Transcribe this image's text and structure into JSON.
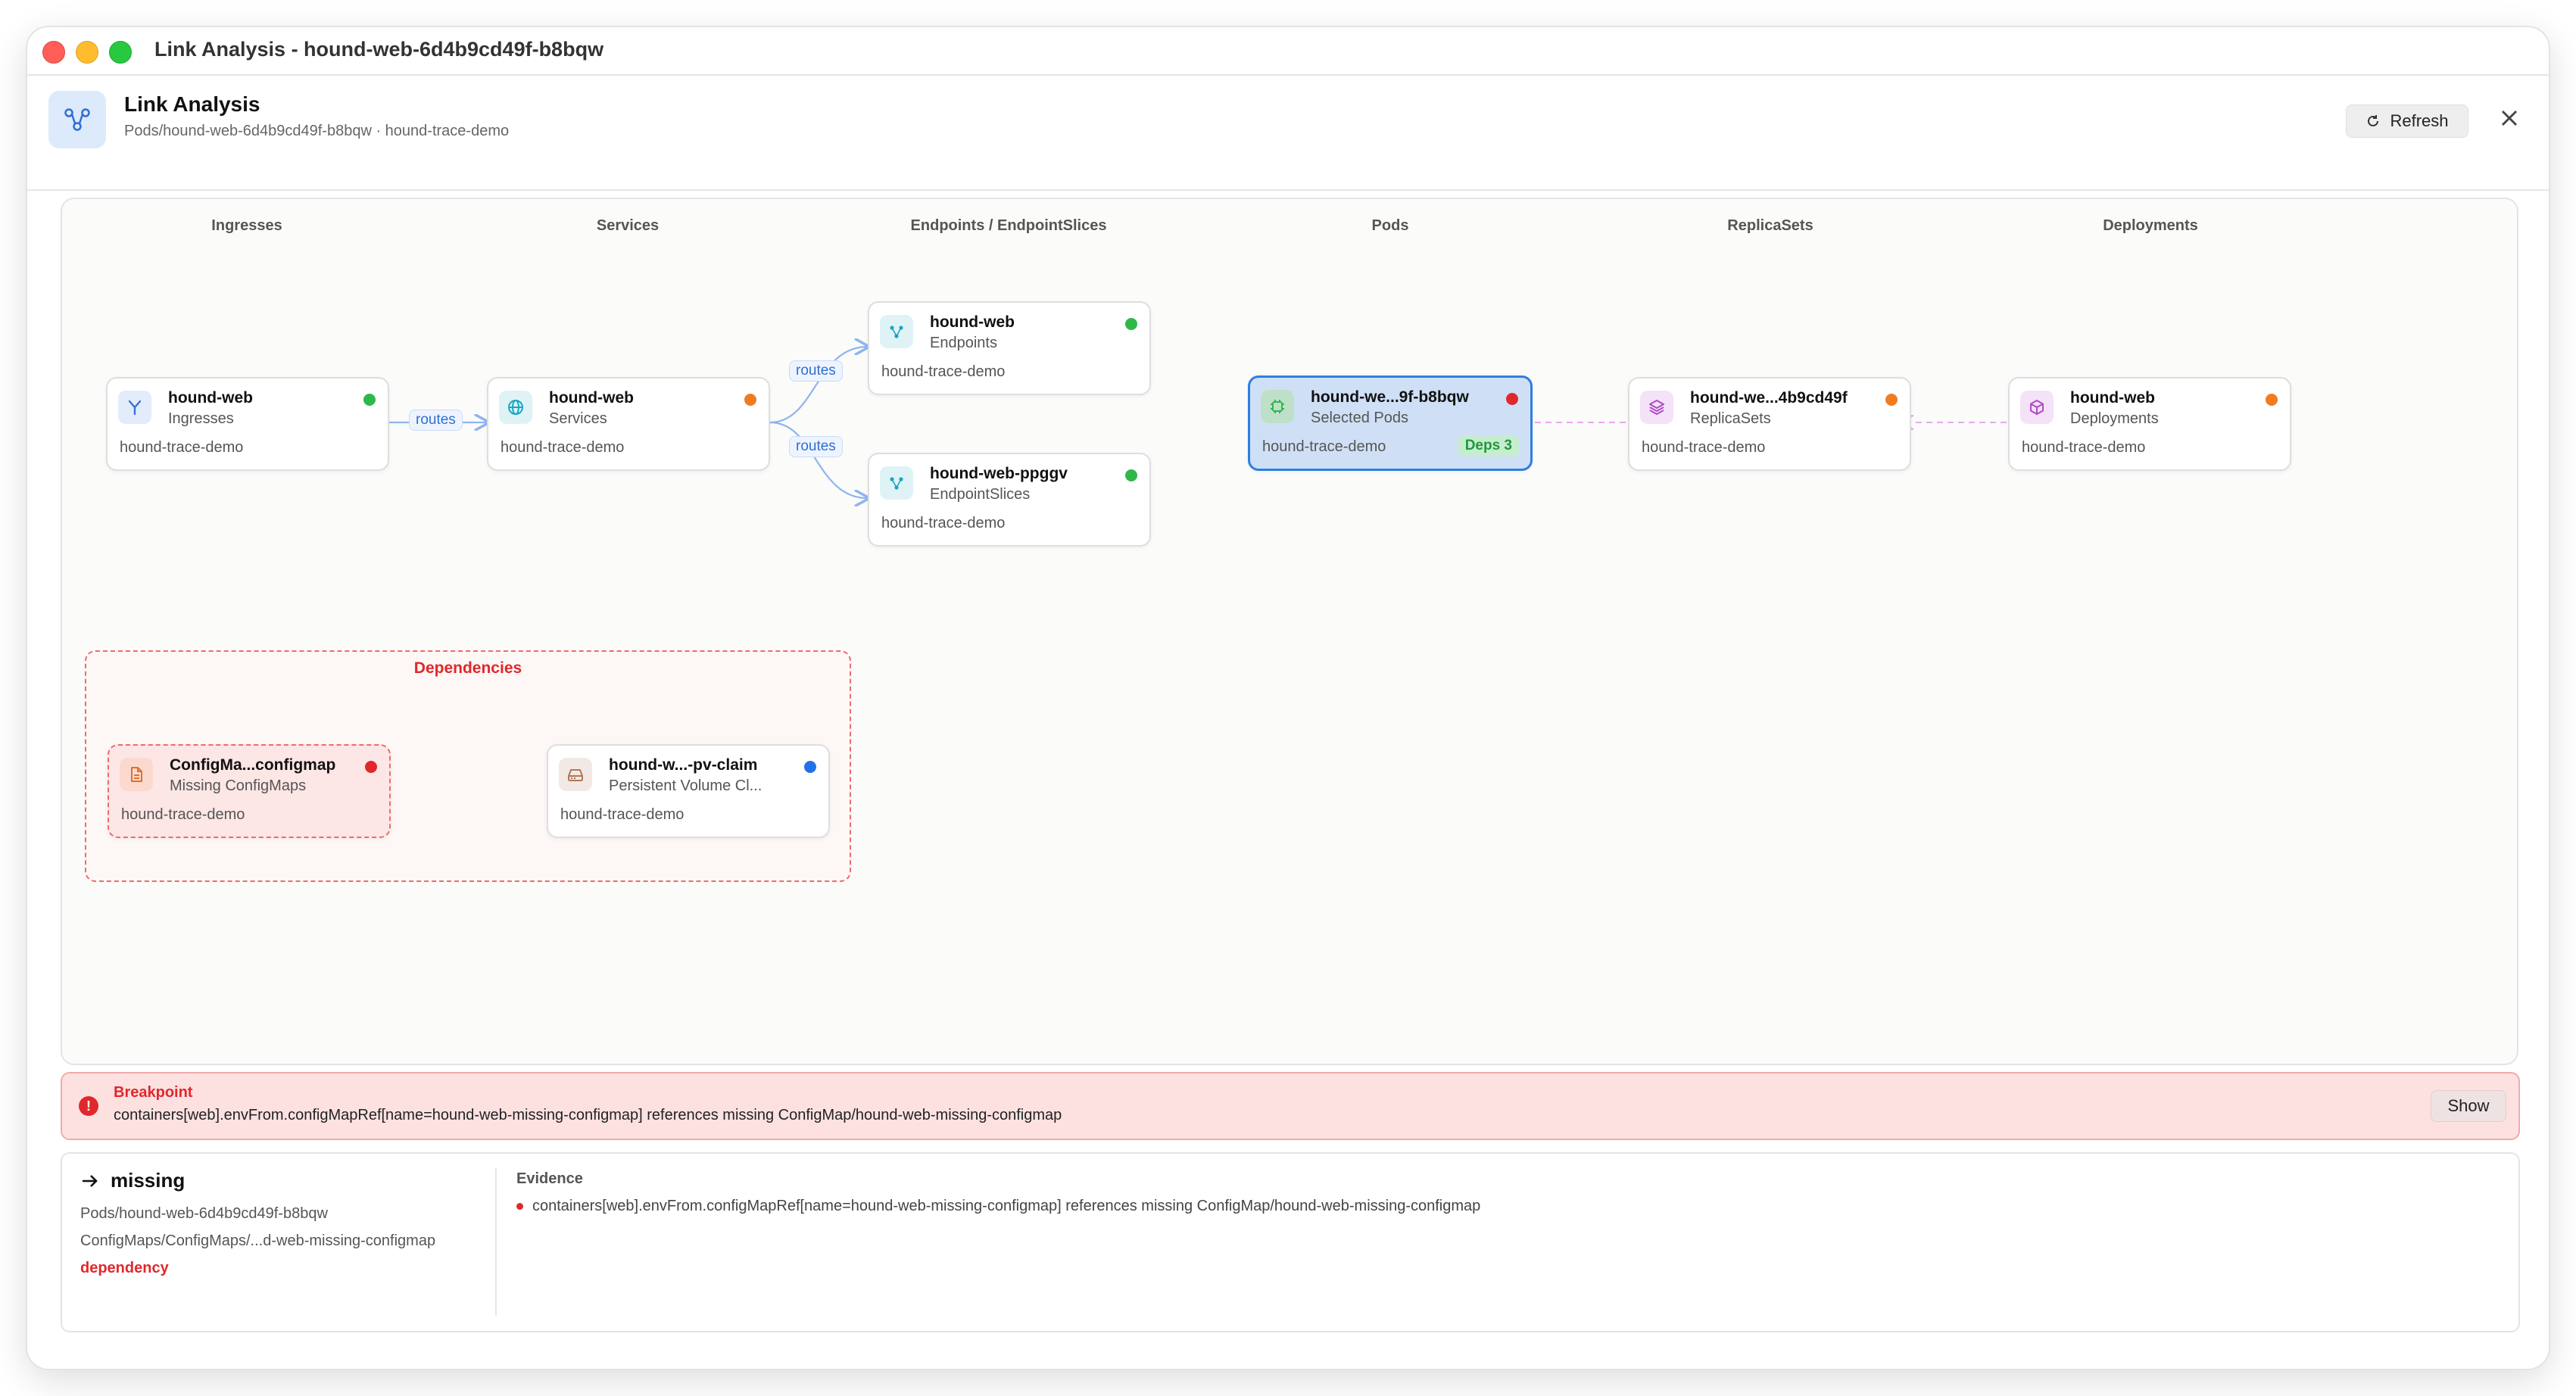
{
  "window": {
    "title": "Link Analysis - hound-web-6d4b9cd49f-b8bqw"
  },
  "header": {
    "title": "Link Analysis",
    "subtitle": "Pods/hound-web-6d4b9cd49f-b8bqw · hound-trace-demo",
    "refresh_label": "Refresh"
  },
  "columns": [
    "Ingresses",
    "Services",
    "Endpoints / EndpointSlices",
    "Pods",
    "ReplicaSets",
    "Deployments"
  ],
  "nodes": {
    "ingress": {
      "name": "hound-web",
      "kind": "Ingresses",
      "namespace": "hound-trace-demo",
      "status_color": "#2fb84a",
      "icon_color": "#3b6fd8",
      "icon_bg": "#e3ecfb"
    },
    "service": {
      "name": "hound-web",
      "kind": "Services",
      "namespace": "hound-trace-demo",
      "status_color": "#f07c22",
      "icon_color": "#1aa6c2",
      "icon_bg": "#dff3f7"
    },
    "endpoints": {
      "name": "hound-web",
      "kind": "Endpoints",
      "namespace": "hound-trace-demo",
      "status_color": "#2fb84a",
      "icon_color": "#1aa6c2",
      "icon_bg": "#dff3f7"
    },
    "endpointslice": {
      "name": "hound-web-ppggv",
      "kind": "EndpointSlices",
      "namespace": "hound-trace-demo",
      "status_color": "#2fb84a",
      "icon_color": "#1aa6c2",
      "icon_bg": "#dff3f7"
    },
    "pod": {
      "name": "hound-we...9f-b8bqw",
      "kind": "Selected Pods",
      "namespace": "hound-trace-demo",
      "status_color": "#e0282c",
      "deps_label": "Deps 3",
      "icon_color": "#2fb84a",
      "icon_bg": "#bfe0c8"
    },
    "replicaset": {
      "name": "hound-we...4b9cd49f",
      "kind": "ReplicaSets",
      "namespace": "hound-trace-demo",
      "status_color": "#f07c22",
      "icon_color": "#b04ac8",
      "icon_bg": "#f4e2f8"
    },
    "deployment": {
      "name": "hound-web",
      "kind": "Deployments",
      "namespace": "hound-trace-demo",
      "status_color": "#f07c22",
      "icon_color": "#b04ac8",
      "icon_bg": "#f4e2f8"
    },
    "configmap": {
      "name": "ConfigMa...configmap",
      "kind": "Missing ConfigMaps",
      "namespace": "hound-trace-demo",
      "status_color": "#e0282c",
      "icon_color": "#e0702c",
      "icon_bg": "#fbd9cf"
    },
    "pvc": {
      "name": "hound-w...-pv-claim",
      "kind": "Persistent Volume Cl...",
      "namespace": "hound-trace-demo",
      "status_color": "#2172e8",
      "icon_color": "#b0775a",
      "icon_bg": "#f3e9e4"
    }
  },
  "edges": {
    "routes_label": "routes"
  },
  "dependencies": {
    "title": "Dependencies"
  },
  "breakpoint": {
    "title": "Breakpoint",
    "message": "containers[web].envFrom.configMapRef[name=hound-web-missing-configmap] references missing ConfigMap/hound-web-missing-configmap",
    "show_label": "Show"
  },
  "detail": {
    "title": "missing",
    "source": "Pods/hound-web-6d4b9cd49f-b8bqw",
    "target": "ConfigMaps/ConfigMaps/...d-web-missing-configmap",
    "relation": "dependency",
    "evidence_title": "Evidence",
    "evidence": [
      "containers[web].envFrom.configMapRef[name=hound-web-missing-configmap] references missing ConfigMap/hound-web-missing-configmap"
    ]
  }
}
